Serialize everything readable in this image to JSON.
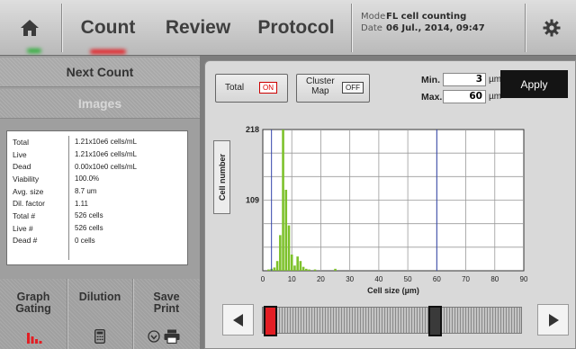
{
  "topbar": {
    "tabs": [
      "Count",
      "Review",
      "Protocol"
    ],
    "mode_label": "Mode",
    "mode_value": "FL cell counting",
    "date_label": "Date",
    "date_value": "06 Jul., 2014, 09:47"
  },
  "icons": {
    "home": "home-icon",
    "settings": "gear-icon",
    "graph_gating": "bar-chart-icon",
    "dilution": "calculator-icon",
    "save_print": "printer-icon",
    "left_arrow": "left-arrow-icon",
    "right_arrow": "right-arrow-icon"
  },
  "colors": {
    "accent_red": "#e31e24",
    "bar_green": "#7dc12b",
    "gate_line": "#3344aa"
  },
  "left_panel": {
    "next_count": "Next Count",
    "images": "Images",
    "results": [
      {
        "label": "Total",
        "value": "1.21x10e6 cells/mL"
      },
      {
        "label": "Live",
        "value": "1.21x10e6 cells/mL"
      },
      {
        "label": "Dead",
        "value": "0.00x10e0 cells/mL"
      },
      {
        "label": "Viability",
        "value": "100.0%"
      },
      {
        "label": "Avg. size",
        "value": "8.7 um"
      },
      {
        "label": "Dil. factor",
        "value": "1.11"
      },
      {
        "label": "Total #",
        "value": "526 cells"
      },
      {
        "label": "Live #",
        "value": "526 cells"
      },
      {
        "label": "Dead #",
        "value": "0 cells"
      }
    ],
    "bottom_buttons": {
      "graph_gating": "Graph\nGating",
      "dilution": "Dilution",
      "save_print": "Save\nPrint"
    }
  },
  "controls": {
    "total_label": "Total",
    "total_state": "ON",
    "cluster_label": "Cluster\nMap",
    "cluster_state": "OFF",
    "min_label": "Min.",
    "min_value": "3",
    "max_label": "Max.",
    "max_value": "60",
    "unit": "µm",
    "apply": "Apply"
  },
  "chart_data": {
    "type": "bar",
    "xlabel": "Cell size (µm)",
    "ylabel": "Cell number",
    "xlim": [
      0,
      90
    ],
    "ylim": [
      0,
      218
    ],
    "x_ticks": [
      0,
      10,
      20,
      30,
      40,
      50,
      60,
      70,
      80,
      90
    ],
    "y_ticks": [
      109,
      218
    ],
    "gate_min": 3,
    "gate_max": 60,
    "x": [
      2,
      3,
      4,
      5,
      6,
      7,
      8,
      9,
      10,
      11,
      12,
      13,
      14,
      15,
      16,
      18,
      25
    ],
    "values": [
      2,
      3,
      5,
      15,
      55,
      218,
      125,
      70,
      25,
      8,
      22,
      15,
      6,
      3,
      2,
      2,
      3
    ]
  },
  "slider": {
    "min_fraction": 0.03,
    "max_fraction": 0.667
  }
}
